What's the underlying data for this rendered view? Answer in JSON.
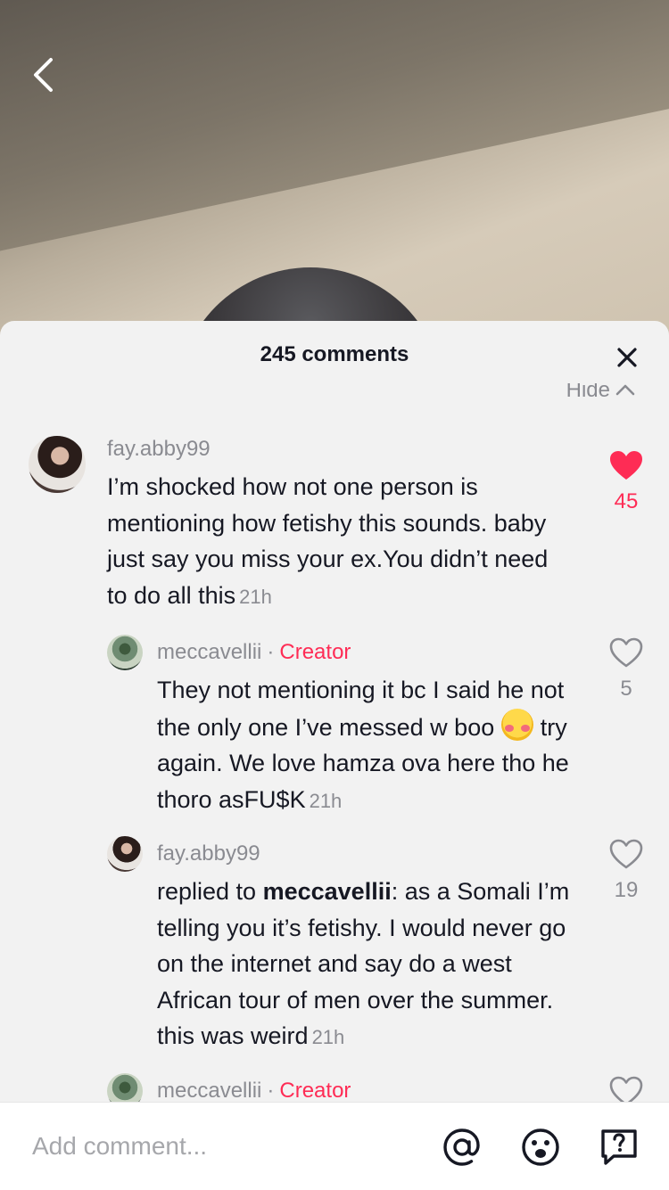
{
  "header": {
    "comment_count_title": "245 comments",
    "hide_label": "Hide"
  },
  "comments": [
    {
      "username": "fay.abby99",
      "text": "I’m shocked how not one person is mentioning how fetishy this sounds. baby just say you miss your ex.You didn’t need to do all this",
      "time": "21h",
      "likes": "45",
      "liked": true
    },
    {
      "username": "meccavellii",
      "badge": "Creator",
      "text_before_emoji": "They not mentioning it bc I said he not the only one I’ve messed w boo",
      "emoji": "smiling-face-with-hearts",
      "text_after_emoji": "try again. We love hamza ova here tho he thoro asFU$K",
      "time": "21h",
      "likes": "5",
      "liked": false
    },
    {
      "username": "fay.abby99",
      "replied_prefix": "replied to",
      "replied_user": "meccavellii",
      "text": ": as a Somali I’m telling you it’s fetishy. I would never go on the internet and say do a west African tour of men over the summer. this was weird",
      "time": "21h",
      "likes": "19",
      "liked": false
    },
    {
      "username": "meccavellii",
      "badge": "Creator"
    }
  ],
  "bottom_bar": {
    "placeholder": "Add comment...",
    "icons": [
      "at-mention-icon",
      "emoji-icon",
      "question-icon"
    ]
  },
  "colors": {
    "accent": "#fe2c55",
    "muted": "#8a8b91",
    "text": "#161823",
    "sheet": "#f2f2f2"
  }
}
